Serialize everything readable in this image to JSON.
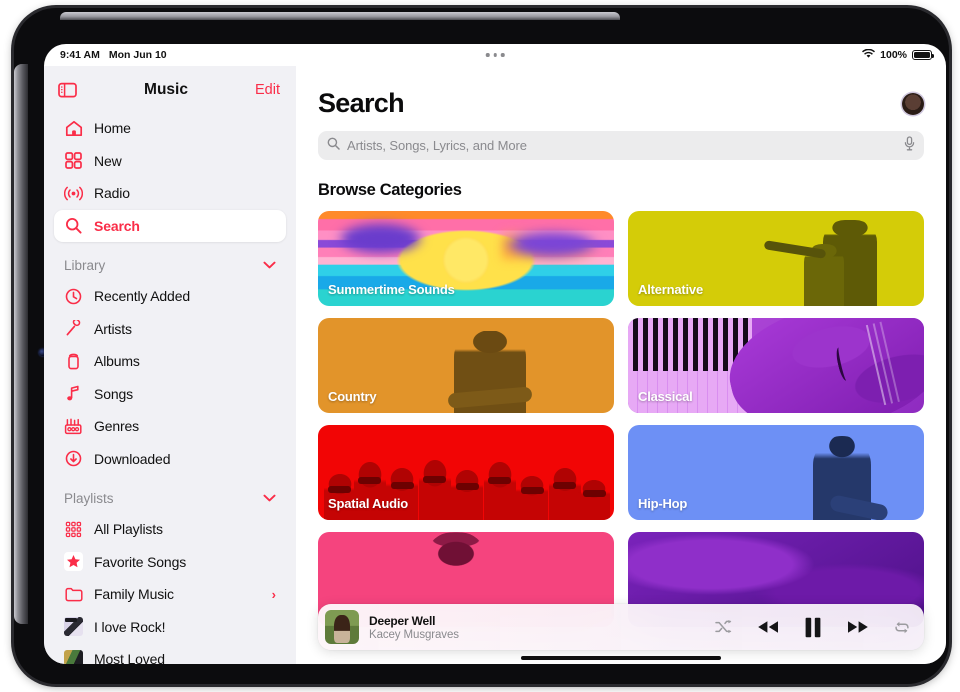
{
  "status_bar": {
    "time": "9:41 AM",
    "date": "Mon Jun 10",
    "battery_percent": "100%",
    "wifi_icon": "wifi-icon",
    "battery_icon": "battery-full-icon",
    "multitask_icon": "multitask-dots-icon"
  },
  "sidebar": {
    "toggle_icon": "sidebar-toggle-icon",
    "title": "Music",
    "edit_label": "Edit",
    "primary_items": [
      {
        "label": "Home",
        "icon": "home-icon",
        "selected": false
      },
      {
        "label": "New",
        "icon": "grid-squares-icon",
        "selected": false
      },
      {
        "label": "Radio",
        "icon": "radio-waves-icon",
        "selected": false
      },
      {
        "label": "Search",
        "icon": "search-icon",
        "selected": true
      }
    ],
    "library": {
      "title": "Library",
      "chevron_icon": "chevron-down-icon",
      "items": [
        {
          "label": "Recently Added",
          "icon": "clock-icon"
        },
        {
          "label": "Artists",
          "icon": "microphone-icon"
        },
        {
          "label": "Albums",
          "icon": "album-icon"
        },
        {
          "label": "Songs",
          "icon": "music-note-icon"
        },
        {
          "label": "Genres",
          "icon": "genres-icon"
        },
        {
          "label": "Downloaded",
          "icon": "download-circle-icon"
        }
      ]
    },
    "playlists": {
      "title": "Playlists",
      "chevron_icon": "chevron-down-icon",
      "items": [
        {
          "label": "All Playlists",
          "icon": "playlists-grid-icon",
          "disclosure": ""
        },
        {
          "label": "Favorite Songs",
          "icon": "star-icon",
          "disclosure": ""
        },
        {
          "label": "Family Music",
          "icon": "folder-icon",
          "disclosure": "›"
        },
        {
          "label": "I love Rock!",
          "icon": "playlist-artwork-thumbnail",
          "disclosure": ""
        },
        {
          "label": "Most Loved",
          "icon": "playlist-artwork-thumbnail",
          "disclosure": ""
        }
      ]
    }
  },
  "main": {
    "page_title": "Search",
    "avatar_icon": "user-avatar",
    "search": {
      "placeholder": "Artists, Songs, Lyrics, and More",
      "value": "",
      "search_icon": "search-icon",
      "mic_icon": "microphone-icon"
    },
    "browse": {
      "section_title": "Browse Categories",
      "tiles": [
        {
          "label": "Summertime Sounds",
          "art": "summer",
          "color": "#ff8fc4"
        },
        {
          "label": "Alternative",
          "art": "alt",
          "color": "#d4cc08"
        },
        {
          "label": "Country",
          "art": "country",
          "color": "#e2942a"
        },
        {
          "label": "Classical",
          "art": "classical",
          "color": "#a93ad8"
        },
        {
          "label": "Spatial Audio",
          "art": "spatial",
          "color": "#f20505"
        },
        {
          "label": "Hip-Hop",
          "art": "hiphop",
          "color": "#6d90f5"
        },
        {
          "label": "",
          "art": "pink",
          "color": "#f5447e"
        },
        {
          "label": "",
          "art": "purple",
          "color": "#7a23bb"
        }
      ]
    }
  },
  "mini_player": {
    "artwork_icon": "now-playing-artwork",
    "track_title": "Deeper Well",
    "track_artist": "Kacey Musgraves",
    "controls": [
      {
        "name": "shuffle-button",
        "icon": "shuffle-icon"
      },
      {
        "name": "previous-button",
        "icon": "rewind-icon"
      },
      {
        "name": "play-pause-button",
        "icon": "pause-icon"
      },
      {
        "name": "next-button",
        "icon": "fast-forward-icon"
      },
      {
        "name": "repeat-button",
        "icon": "repeat-icon"
      }
    ]
  },
  "theme": {
    "accent": "#fa2d48",
    "sidebar_bg": "#f1f1f5",
    "content_bg": "#ffffff",
    "muted_text": "#8a8a8e"
  }
}
